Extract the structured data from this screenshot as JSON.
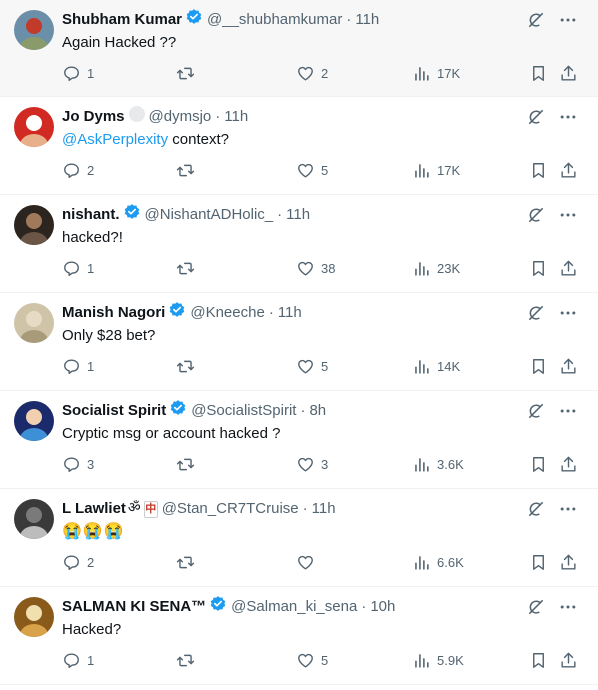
{
  "tweets": [
    {
      "name": "Shubham Kumar",
      "verified": true,
      "handle": "@__shubhamkumar",
      "time": "11h",
      "text": "Again Hacked ??",
      "replies": "1",
      "retweets": "",
      "likes": "2",
      "views": "17K",
      "avatar_colors": [
        "#6b8fa8",
        "#8a9a6a",
        "#c23b2a"
      ]
    },
    {
      "name": "Jo Dyms",
      "verified": false,
      "handle": "@dymsjo",
      "time": "11h",
      "mention": "@AskPerplexity",
      "text": " context?",
      "replies": "2",
      "retweets": "",
      "likes": "5",
      "views": "17K",
      "avatar_colors": [
        "#d02a22",
        "#e8b08a",
        "#ffffff"
      ]
    },
    {
      "name": "nishant.",
      "verified": true,
      "handle": "@NishantADHolic_",
      "time": "11h",
      "text": "hacked?!",
      "replies": "1",
      "retweets": "",
      "likes": "38",
      "views": "23K",
      "avatar_colors": [
        "#2b241f",
        "#6a5546",
        "#a07a5a"
      ]
    },
    {
      "name": "Manish Nagori",
      "verified": true,
      "handle": "@Kneeche",
      "time": "11h",
      "text": "Only $28 bet?",
      "replies": "1",
      "retweets": "",
      "likes": "5",
      "views": "14K",
      "avatar_colors": [
        "#cfc3a8",
        "#a89b7a",
        "#e6dcc5"
      ]
    },
    {
      "name": "Socialist Spirit",
      "verified": true,
      "handle": "@SocialistSpirit",
      "time": "8h",
      "text": "Cryptic msg or account hacked ?",
      "replies": "3",
      "retweets": "",
      "likes": "3",
      "views": "3.6K",
      "avatar_colors": [
        "#1a2a6b",
        "#3d8fd6",
        "#f0d0b0"
      ]
    },
    {
      "name": "L Lawliet",
      "verified": false,
      "badge": "ॐ",
      "badge2": "中",
      "handle": "@Stan_CR7TCruise",
      "time": "11h",
      "text": "😭😭😭",
      "replies": "2",
      "retweets": "",
      "likes": "",
      "views": "6.6K",
      "avatar_colors": [
        "#3a3a3a",
        "#bcbcbc",
        "#7a7a7a"
      ]
    },
    {
      "name": "SALMAN KI SENA™",
      "verified": true,
      "handle": "@Salman_ki_sena",
      "time": "10h",
      "text": "Hacked?",
      "replies": "1",
      "retweets": "",
      "likes": "5",
      "views": "5.9K",
      "avatar_colors": [
        "#8a5a1a",
        "#d9a24a",
        "#f0e0b0"
      ]
    }
  ],
  "colors": {
    "accent": "#1d9bf0",
    "muted": "#536471",
    "text": "#0f1419"
  },
  "icons": {
    "reply": "reply-icon",
    "retweet": "retweet-icon",
    "like": "like-icon",
    "views": "views-icon",
    "bookmark": "bookmark-icon",
    "share": "share-icon",
    "grok": "grok-icon",
    "more": "more-icon",
    "verified": "verified-badge-icon"
  }
}
